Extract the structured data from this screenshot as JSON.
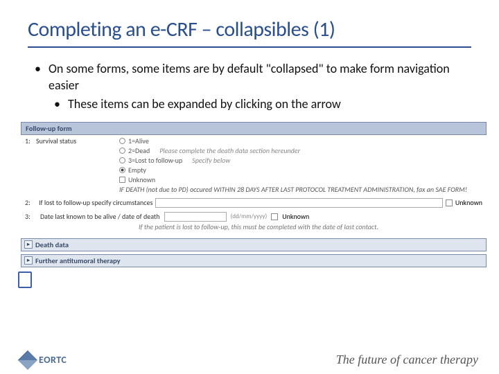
{
  "title": "Completing an e-CRF – collapsibles (1)",
  "bullets": {
    "b1": "On some forms, some items are by default \"collapsed\" to make form navigation easier",
    "b2": "These items can be expanded by clicking on the arrow"
  },
  "form": {
    "header": "Follow-up form",
    "q1": {
      "num": "1:",
      "label": "Survival status",
      "opts": {
        "o1": "1=Alive",
        "o2": "2=Dead",
        "o2hint": "Please complete the death data section hereunder",
        "o3": "3=Lost to follow-up",
        "o3hint": "Specify below",
        "o4": "Empty",
        "o5": "Unknown"
      },
      "warn": "IF DEATH (not due to PD) occured WITHIN 28 DAYS AFTER LAST PROTOCOL TREATMENT ADMINISTRATION, fax an SAE FORM!"
    },
    "q2": {
      "num": "2:",
      "label": "If lost to follow-up specify circumstances",
      "unknown": "Unknown"
    },
    "q3": {
      "num": "3:",
      "label": "Date last known to be alive / date of death",
      "hint": "(dd/mm/yyyy)",
      "unknown": "Unknown",
      "note": "If the patient is lost to follow-up, this must be completed with the date of last contact."
    },
    "collapsibles": {
      "c1": "Death data",
      "c2": "Further antitumoral therapy"
    }
  },
  "footer": {
    "logo": "EORTC",
    "tagline": "The future of cancer therapy"
  }
}
